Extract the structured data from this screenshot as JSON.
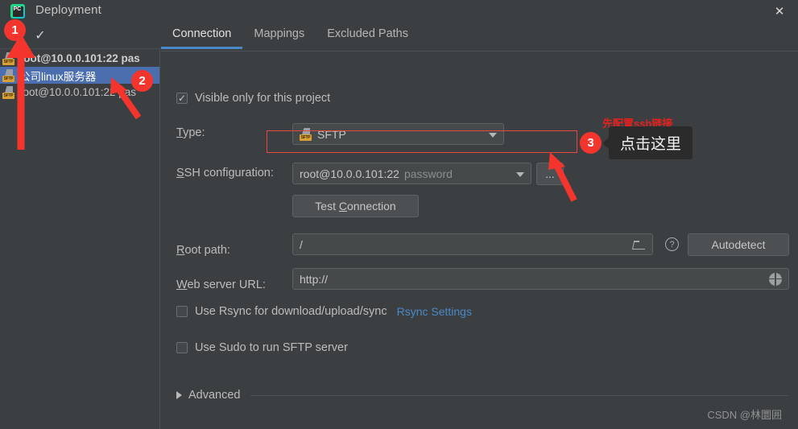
{
  "window": {
    "title": "Deployment",
    "app_icon": "pycharm-logo-icon",
    "app_icon_text": "PC",
    "close_label": "✕"
  },
  "left_panel": {
    "toolbar": {
      "remove_label": "−",
      "apply_label": "✓"
    },
    "servers": [
      {
        "label": "root@10.0.0.101:22 pas",
        "selected": false,
        "bold": true
      },
      {
        "label": "公司linux服务器",
        "selected": true,
        "bold": false
      },
      {
        "label": "root@10.0.0.101:22 pas",
        "selected": false,
        "bold": false
      }
    ]
  },
  "tabs": [
    {
      "label": "Connection",
      "active": true
    },
    {
      "label": "Mappings",
      "active": false
    },
    {
      "label": "Excluded Paths",
      "active": false
    }
  ],
  "form": {
    "visible_only_label": "Visible only for this project",
    "visible_only_checked": true,
    "type_label": "Type:",
    "type_value": "SFTP",
    "ssh_config_label": "SSH configuration:",
    "ssh_config_value": "root@10.0.0.101:22",
    "ssh_config_hint": "password",
    "ssh_browse_label": "...",
    "test_connection_label": "Test Connection",
    "root_path_label": "Root path:",
    "root_path_value": "/",
    "autodetect_label": "Autodetect",
    "web_server_url_label": "Web server URL:",
    "web_server_url_value": "http://",
    "rsync_label": "Use Rsync for download/upload/sync",
    "rsync_checked": false,
    "rsync_settings_link": "Rsync Settings",
    "sudo_label": "Use Sudo to run SFTP server",
    "sudo_checked": false,
    "advanced_label": "Advanced"
  },
  "annotations": {
    "badge_1": "1",
    "badge_2": "2",
    "badge_3": "3",
    "red_note": "先配置ssh链接",
    "tooltip": "点击这里"
  },
  "watermark": "CSDN @林圜囲",
  "colors": {
    "background": "#3c3f41",
    "selection_blue": "#4b6eaf",
    "tab_accent": "#4a88c7",
    "link_blue": "#4a88c7",
    "annotation_red": "#f4352e",
    "sftp_tag": "#d9a036"
  }
}
